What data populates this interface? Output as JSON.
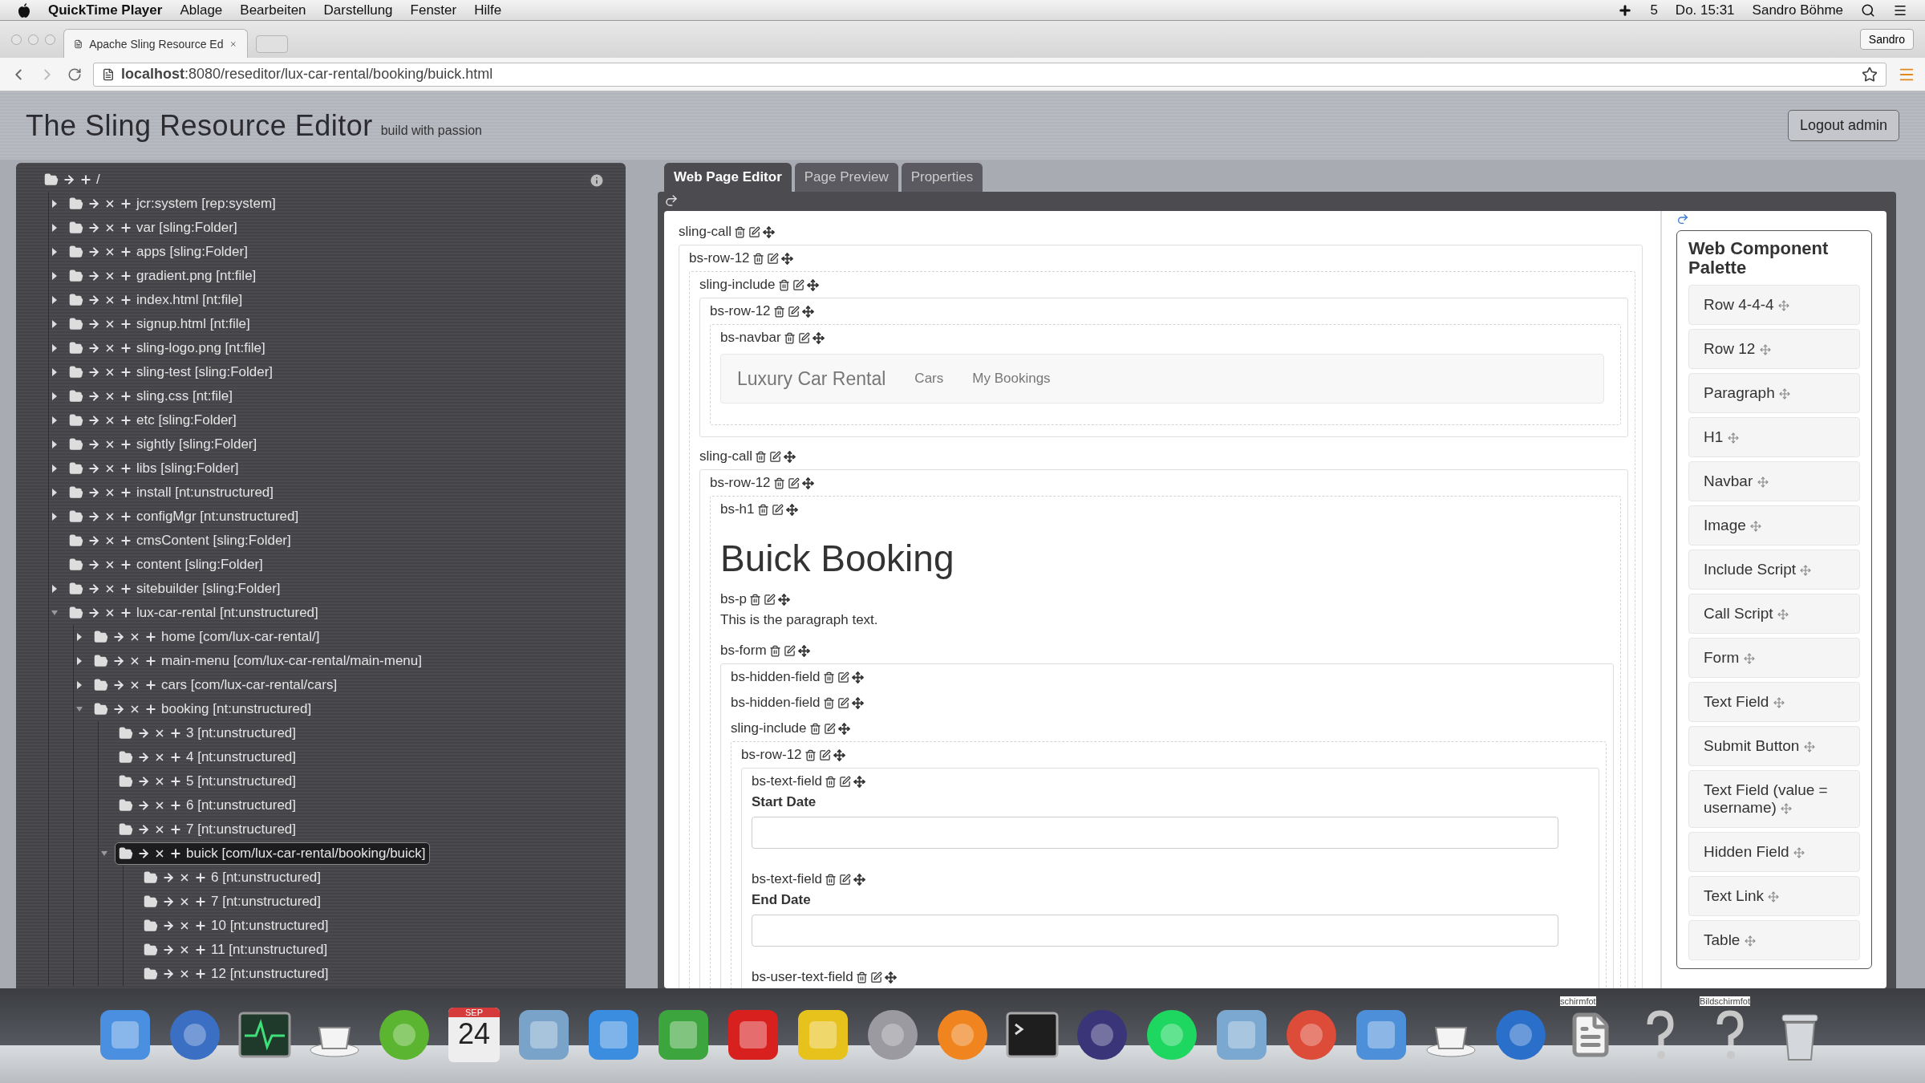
{
  "menubar": {
    "app": "QuickTime Player",
    "menus": [
      "Ablage",
      "Bearbeiten",
      "Darstellung",
      "Fenster",
      "Hilfe"
    ],
    "status_badge": "5",
    "clock": "Do. 15:31",
    "user": "Sandro Böhme"
  },
  "browser": {
    "tab_title": "Apache Sling Resource Ed",
    "profile": "Sandro",
    "url": "**localhost**:8080/reseditor/lux-car-rental/booking/buick.html"
  },
  "header": {
    "title": "The Sling Resource Editor",
    "tagline": "build with passion",
    "logout": "Logout admin"
  },
  "tree": [
    {
      "kind": "root",
      "label": "/",
      "selected": false,
      "children": [
        {
          "kind": "branch",
          "label": "jcr:system [rep:system]",
          "expanded": false,
          "selected": false
        },
        {
          "kind": "branch",
          "label": "var [sling:Folder]",
          "expanded": false,
          "selected": false
        },
        {
          "kind": "branch",
          "label": "apps [sling:Folder]",
          "expanded": false,
          "selected": false
        },
        {
          "kind": "branch",
          "label": "gradient.png [nt:file]",
          "expanded": false,
          "selected": false
        },
        {
          "kind": "branch",
          "label": "index.html [nt:file]",
          "expanded": false,
          "selected": false
        },
        {
          "kind": "branch",
          "label": "signup.html [nt:file]",
          "expanded": false,
          "selected": false
        },
        {
          "kind": "branch",
          "label": "sling-logo.png [nt:file]",
          "expanded": false,
          "selected": false
        },
        {
          "kind": "branch",
          "label": "sling-test [sling:Folder]",
          "expanded": false,
          "selected": false
        },
        {
          "kind": "branch",
          "label": "sling.css [nt:file]",
          "expanded": false,
          "selected": false
        },
        {
          "kind": "branch",
          "label": "etc [sling:Folder]",
          "expanded": false,
          "selected": false
        },
        {
          "kind": "branch",
          "label": "sightly [sling:Folder]",
          "expanded": false,
          "selected": false
        },
        {
          "kind": "branch",
          "label": "libs [sling:Folder]",
          "expanded": false,
          "selected": false
        },
        {
          "kind": "branch",
          "label": "install [nt:unstructured]",
          "expanded": false,
          "selected": false
        },
        {
          "kind": "branch",
          "label": "configMgr [nt:unstructured]",
          "expanded": false,
          "selected": false
        },
        {
          "kind": "leaf",
          "label": "cmsContent [sling:Folder]",
          "selected": false
        },
        {
          "kind": "leaf",
          "label": "content [sling:Folder]",
          "selected": false
        },
        {
          "kind": "branch",
          "label": "sitebuilder [sling:Folder]",
          "expanded": false,
          "selected": false
        },
        {
          "kind": "branch",
          "label": "lux-car-rental [nt:unstructured]",
          "expanded": true,
          "selected": false,
          "children": [
            {
              "kind": "branch",
              "label": "home [com/lux-car-rental/]",
              "expanded": false,
              "selected": false
            },
            {
              "kind": "branch",
              "label": "main-menu [com/lux-car-rental/main-menu]",
              "expanded": false,
              "selected": false
            },
            {
              "kind": "branch",
              "label": "cars [com/lux-car-rental/cars]",
              "expanded": false,
              "selected": false
            },
            {
              "kind": "branch",
              "label": "booking [nt:unstructured]",
              "expanded": true,
              "selected": false,
              "children": [
                {
                  "kind": "leaf",
                  "label": "3 [nt:unstructured]",
                  "selected": false
                },
                {
                  "kind": "leaf",
                  "label": "4 [nt:unstructured]",
                  "selected": false
                },
                {
                  "kind": "leaf",
                  "label": "5 [nt:unstructured]",
                  "selected": false
                },
                {
                  "kind": "leaf",
                  "label": "6 [nt:unstructured]",
                  "selected": false
                },
                {
                  "kind": "leaf",
                  "label": "7 [nt:unstructured]",
                  "selected": false
                },
                {
                  "kind": "branch",
                  "label": "buick [com/lux-car-rental/booking/buick]",
                  "expanded": true,
                  "selected": true,
                  "children": [
                    {
                      "kind": "leaf",
                      "label": "6 [nt:unstructured]",
                      "selected": false
                    },
                    {
                      "kind": "leaf",
                      "label": "7 [nt:unstructured]",
                      "selected": false
                    },
                    {
                      "kind": "leaf",
                      "label": "10 [nt:unstructured]",
                      "selected": false
                    },
                    {
                      "kind": "leaf",
                      "label": "11 [nt:unstructured]",
                      "selected": false
                    },
                    {
                      "kind": "leaf",
                      "label": "12 [nt:unstructured]",
                      "selected": false
                    }
                  ]
                }
              ]
            }
          ]
        }
      ]
    }
  ],
  "tabs": [
    {
      "label": "Web Page Editor",
      "selected": true
    },
    {
      "label": "Page Preview",
      "selected": false
    },
    {
      "label": "Properties",
      "selected": false
    }
  ],
  "editor": [
    {
      "kind": "component",
      "label": "sling-call",
      "children": [
        {
          "kind": "component",
          "label": "bs-row-12",
          "children": [
            {
              "kind": "component",
              "label": "sling-include",
              "children": [
                {
                  "kind": "component",
                  "label": "bs-row-12",
                  "children": [
                    {
                      "kind": "component",
                      "label": "bs-navbar",
                      "children": [
                        {
                          "kind": "navbar",
                          "brand": "Luxury Car Rental",
                          "links": [
                            "Cars",
                            "My Bookings"
                          ]
                        }
                      ]
                    }
                  ]
                }
              ]
            },
            {
              "kind": "component",
              "label": "sling-call",
              "children": [
                {
                  "kind": "component",
                  "label": "bs-row-12",
                  "children": [
                    {
                      "kind": "component",
                      "label": "bs-h1",
                      "children": [
                        {
                          "kind": "heading",
                          "text": "Buick Booking"
                        }
                      ]
                    },
                    {
                      "kind": "component",
                      "label": "bs-p",
                      "children": [
                        {
                          "kind": "paragraph",
                          "text": "This is the paragraph text."
                        }
                      ]
                    },
                    {
                      "kind": "component",
                      "label": "bs-form",
                      "children": [
                        {
                          "kind": "component",
                          "label": "bs-hidden-field"
                        },
                        {
                          "kind": "component",
                          "label": "bs-hidden-field"
                        },
                        {
                          "kind": "component",
                          "label": "sling-include",
                          "children": [
                            {
                              "kind": "component",
                              "label": "bs-row-12",
                              "children": [
                                {
                                  "kind": "component",
                                  "label": "bs-text-field",
                                  "children": [
                                    {
                                      "kind": "input",
                                      "label": "Start Date"
                                    }
                                  ]
                                },
                                {
                                  "kind": "component",
                                  "label": "bs-text-field",
                                  "children": [
                                    {
                                      "kind": "input",
                                      "label": "End Date"
                                    }
                                  ]
                                },
                                {
                                  "kind": "component",
                                  "label": "bs-user-text-field"
                                }
                              ]
                            }
                          ]
                        }
                      ]
                    }
                  ]
                }
              ]
            }
          ]
        }
      ]
    }
  ],
  "palette": {
    "title": "Web Component Palette",
    "items": [
      "Row 4-4-4",
      "Row 12",
      "Paragraph",
      "H1",
      "Navbar",
      "Image",
      "Include Script",
      "Call Script",
      "Form",
      "Text Field",
      "Submit Button",
      "Text Field (value = username)",
      "Hidden Field",
      "Text Link",
      "Table"
    ]
  },
  "dock": [
    {
      "kind": "square",
      "color": "#4a8fe0"
    },
    {
      "kind": "circle",
      "color": "#3b6fc4"
    },
    {
      "kind": "pulse"
    },
    {
      "kind": "cup"
    },
    {
      "kind": "circle",
      "color": "#5cb531"
    },
    {
      "kind": "calendar",
      "month": "SEP",
      "day": "24"
    },
    {
      "kind": "square",
      "color": "#7aa3c9"
    },
    {
      "kind": "square",
      "color": "#3b8de0"
    },
    {
      "kind": "square",
      "color": "#3da53d"
    },
    {
      "kind": "square",
      "color": "#d8201f"
    },
    {
      "kind": "square",
      "color": "#e8c21c"
    },
    {
      "kind": "circle",
      "color": "#9a9aa0"
    },
    {
      "kind": "circle",
      "color": "#f0841f"
    },
    {
      "kind": "terminal"
    },
    {
      "kind": "circle",
      "color": "#3a3479"
    },
    {
      "kind": "circle",
      "color": "#1ed760"
    },
    {
      "kind": "square",
      "color": "#7aa8d0"
    },
    {
      "kind": "circle",
      "color": "#dd4b39"
    },
    {
      "kind": "square",
      "color": "#4d8fd8"
    },
    {
      "kind": "cup"
    },
    {
      "kind": "circle",
      "color": "#2a6fc9"
    },
    {
      "kind": "document",
      "caption": "schirmfot"
    },
    {
      "kind": "question"
    },
    {
      "kind": "question",
      "caption": "Bildschirmfot"
    },
    {
      "kind": "trash"
    }
  ]
}
